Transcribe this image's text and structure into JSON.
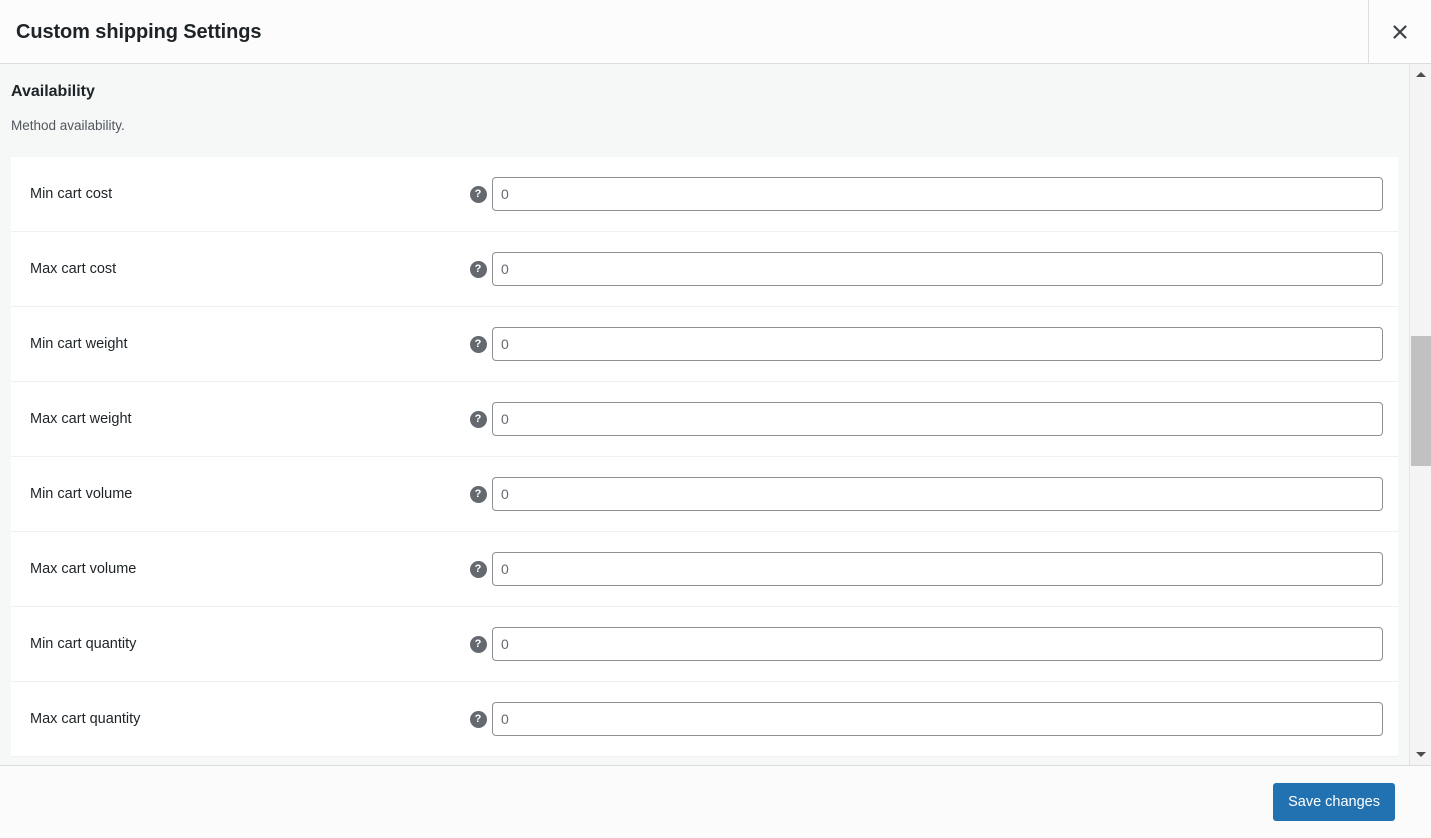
{
  "header": {
    "title": "Custom shipping Settings",
    "close_label": "×"
  },
  "section": {
    "heading": "Availability",
    "description": "Method availability."
  },
  "help_icon": {
    "glyph": "?"
  },
  "fields": [
    {
      "label": "Min cart cost",
      "value": "",
      "placeholder": "0"
    },
    {
      "label": "Max cart cost",
      "value": "",
      "placeholder": "0"
    },
    {
      "label": "Min cart weight",
      "value": "",
      "placeholder": "0"
    },
    {
      "label": "Max cart weight",
      "value": "",
      "placeholder": "0"
    },
    {
      "label": "Min cart volume",
      "value": "",
      "placeholder": "0"
    },
    {
      "label": "Max cart volume",
      "value": "",
      "placeholder": "0"
    },
    {
      "label": "Min cart quantity",
      "value": "",
      "placeholder": "0"
    },
    {
      "label": "Max cart quantity",
      "value": "",
      "placeholder": "0"
    }
  ],
  "footer": {
    "save_label": "Save changes"
  },
  "colors": {
    "accent": "#2271b1",
    "body_bg": "#f6f7f7",
    "text": "#1d2327",
    "muted_text": "#50575e",
    "input_border": "#8c8f94",
    "help_bg": "#646970",
    "scroll_thumb": "#c1c1c1"
  }
}
